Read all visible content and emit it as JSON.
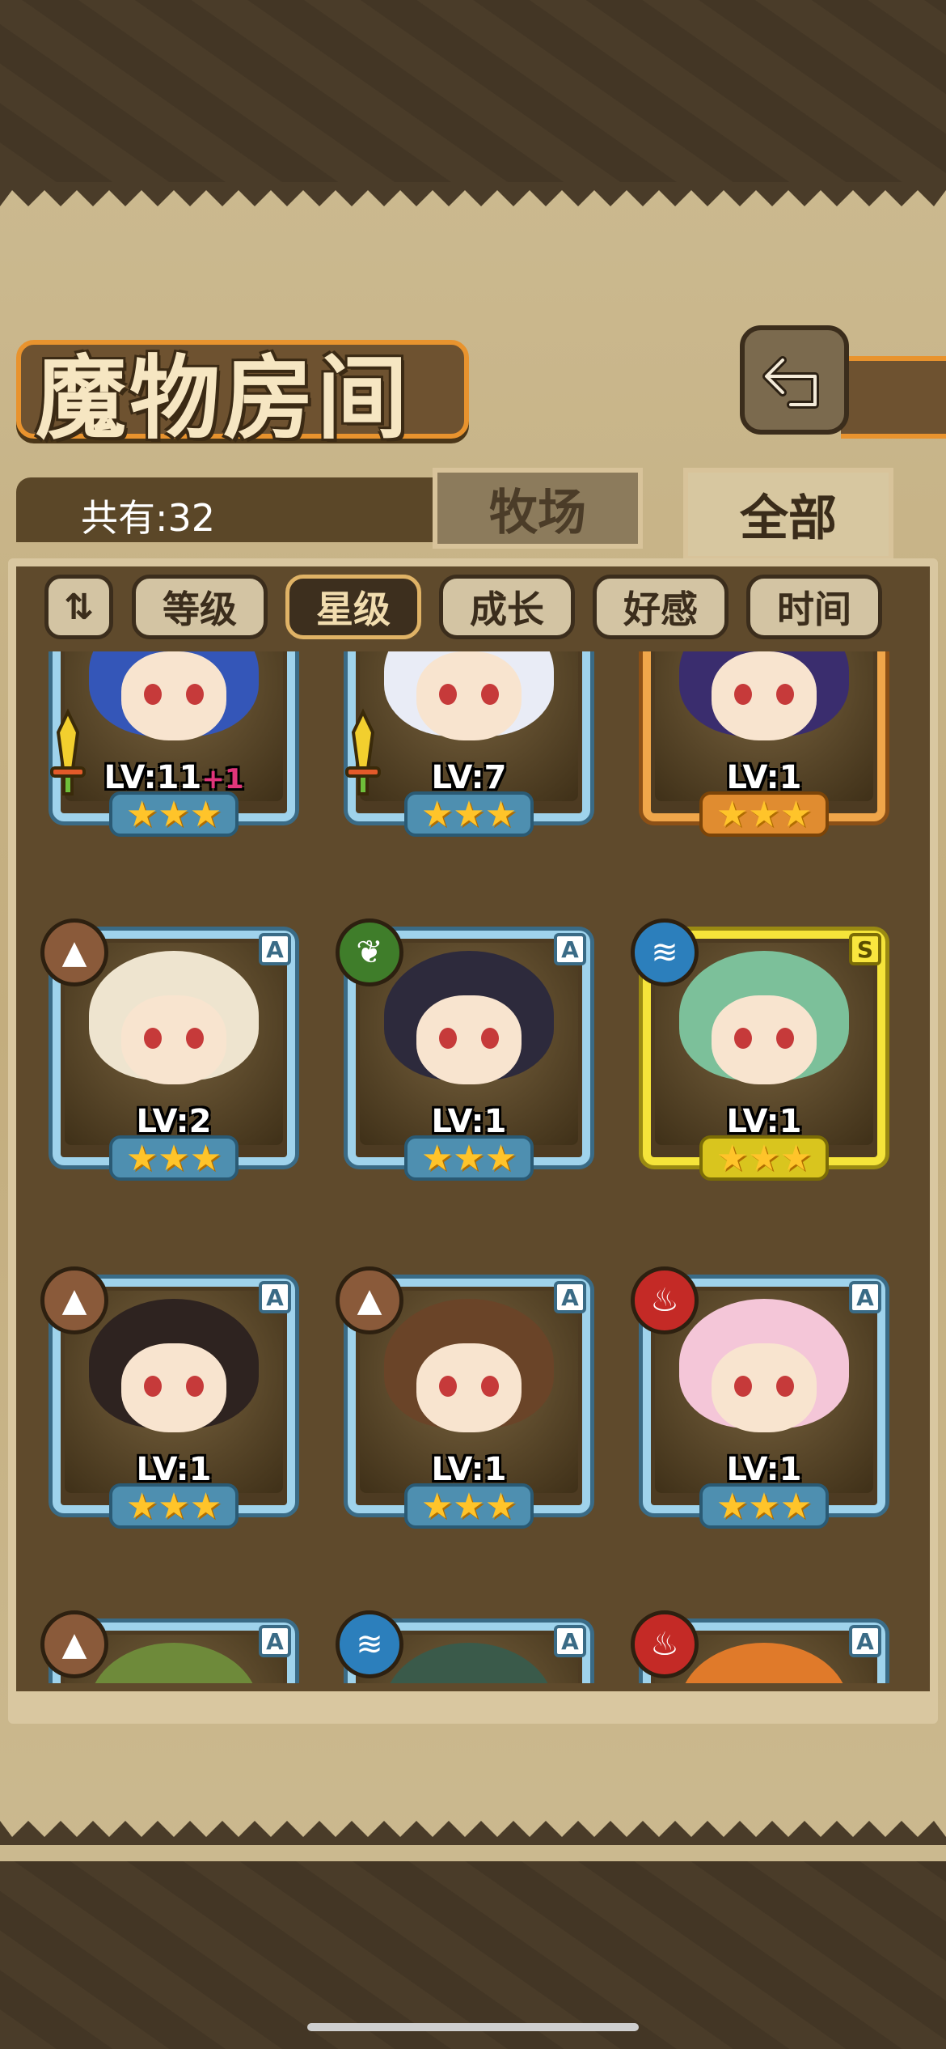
{
  "header": {
    "title": "魔物房间"
  },
  "summary": {
    "count_label": "共有:32"
  },
  "tabs": [
    {
      "label": "牧场",
      "active": false
    },
    {
      "label": "全部",
      "active": true
    }
  ],
  "sort": {
    "toggle_icon": "sort-order-toggle-icon",
    "buttons": [
      {
        "label": "等级",
        "active": false
      },
      {
        "label": "星级",
        "active": true
      },
      {
        "label": "成长",
        "active": false
      },
      {
        "label": "好感",
        "active": false
      },
      {
        "label": "时间",
        "active": false
      }
    ]
  },
  "monsters": [
    {
      "level": "LV:11",
      "bonus": "+1",
      "stars": "★★★",
      "frame": "blue",
      "element": "",
      "rank": "",
      "hair": "#3456b8",
      "weapon": true
    },
    {
      "level": "LV:7",
      "bonus": "",
      "stars": "★★★",
      "frame": "blue",
      "element": "",
      "rank": "",
      "hair": "#e9ecf6",
      "weapon": true
    },
    {
      "level": "LV:1",
      "bonus": "",
      "stars": "★★★",
      "frame": "orange",
      "element": "",
      "rank": "",
      "hair": "#3a2d6e",
      "weapon": false
    },
    {
      "level": "LV:2",
      "bonus": "",
      "stars": "★★★",
      "frame": "blue",
      "element": "earth",
      "rank": "A",
      "hair": "#eee4cf",
      "weapon": false
    },
    {
      "level": "LV:1",
      "bonus": "",
      "stars": "★★★",
      "frame": "blue",
      "element": "wood",
      "rank": "A",
      "hair": "#2d2a3c",
      "weapon": false
    },
    {
      "level": "LV:1",
      "bonus": "",
      "stars": "★★★",
      "frame": "gold",
      "element": "water",
      "rank": "S",
      "hair": "#7cc09a",
      "weapon": false
    },
    {
      "level": "LV:1",
      "bonus": "",
      "stars": "★★★",
      "frame": "blue",
      "element": "earth",
      "rank": "A",
      "hair": "#2e2320",
      "weapon": false
    },
    {
      "level": "LV:1",
      "bonus": "",
      "stars": "★★★",
      "frame": "blue",
      "element": "earth",
      "rank": "A",
      "hair": "#6a4428",
      "weapon": false
    },
    {
      "level": "LV:1",
      "bonus": "",
      "stars": "★★★",
      "frame": "blue",
      "element": "fire",
      "rank": "A",
      "hair": "#f4c6d8",
      "weapon": false
    },
    {
      "level": "",
      "bonus": "",
      "stars": "",
      "frame": "blue",
      "element": "earth",
      "rank": "A",
      "hair": "#6e8a3a",
      "weapon": false
    },
    {
      "level": "",
      "bonus": "",
      "stars": "",
      "frame": "blue",
      "element": "water",
      "rank": "A",
      "hair": "#3a5a4a",
      "weapon": false
    },
    {
      "level": "",
      "bonus": "",
      "stars": "",
      "frame": "blue",
      "element": "fire",
      "rank": "A",
      "hair": "#e07a2a",
      "weapon": false
    }
  ],
  "colors": {
    "panel": "#cbb98f",
    "frame_blue": "#9fd3ec",
    "frame_gold": "#f5e43a",
    "frame_orange": "#f0a64a",
    "accent_orange": "#e8932e"
  }
}
